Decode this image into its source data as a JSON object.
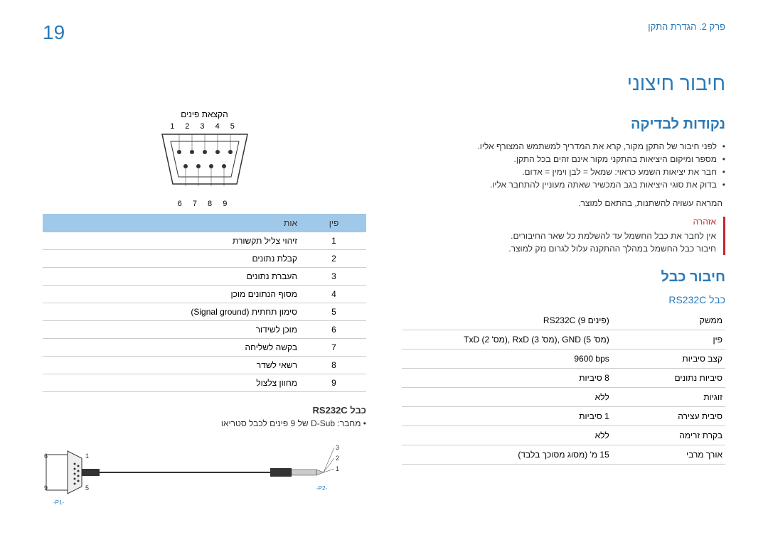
{
  "pageNumber": "19",
  "chapter": "פרק 2. הגדרת התקן",
  "mainTitle": "חיבור חיצוני",
  "section1": {
    "title": "נקודות לבדיקה",
    "bullets": [
      "לפני חיבור של התקן מקור, קרא את המדריך למשתמש המצורף אליו.",
      "מספר ומיקום היציאות בהתקני מקור אינם זהים בכל התקן.",
      "חבר את יציאות השמע כראוי: שמאל = לבן וימין = אדום.",
      "בדוק את סוגי היציאות בגב המכשיר שאתה מעוניין להתחבר אליו."
    ],
    "note": "המראה עשויה להשתנות, בהתאם למוצר.",
    "warning": {
      "title": "אזהרה",
      "line1": "אין לחבר את כבל החשמל עד להשלמת כל שאר החיבורים.",
      "line2": "חיבור כבל החשמל במהלך ההתקנה עלול לגרום נזק למוצר."
    }
  },
  "section2": {
    "title": "חיבור כבל",
    "sub": "כבל RS232C",
    "specs": [
      {
        "label": "ממשק",
        "value": "RS232C (9 פינים)"
      },
      {
        "label": "פין",
        "value": "TxD (מס' 2), RxD (מס' 3), GND (מס' 5)"
      },
      {
        "label": "קצב סיביות",
        "value": "9600 bps"
      },
      {
        "label": "סיביות נתונים",
        "value": "8 סיביות"
      },
      {
        "label": "זוגיות",
        "value": "ללא"
      },
      {
        "label": "סיבית עצירה",
        "value": "1 סיביות"
      },
      {
        "label": "בקרת זרימה",
        "value": "ללא"
      },
      {
        "label": "אורך מרבי",
        "value": "15 מ' (מסוג מסוכך בלבד)"
      }
    ]
  },
  "pinAssignment": {
    "title": "הקצאת פינים",
    "topNums": "1 2 3 4 5",
    "bottomNums": "6 7 8 9",
    "headers": {
      "pin": "פין",
      "signal": "אות"
    },
    "rows": [
      {
        "n": "1",
        "s": "זיהוי צליל תקשורת"
      },
      {
        "n": "2",
        "s": "קבלת נתונים"
      },
      {
        "n": "3",
        "s": "העברת נתונים"
      },
      {
        "n": "4",
        "s": "מסוף הנתונים מוכן"
      },
      {
        "n": "5",
        "s": "סימון תחתית (Signal ground)"
      },
      {
        "n": "6",
        "s": "מוכן לשידור"
      },
      {
        "n": "7",
        "s": "בקשה לשליחה"
      },
      {
        "n": "8",
        "s": "רשאי לשדר"
      },
      {
        "n": "9",
        "s": "מחוון צלצול"
      }
    ]
  },
  "cable": {
    "title": "כבל RS232C",
    "desc": "מחבר: D-Sub של 9 פינים לכבל סטריאו",
    "p1": "-P1-",
    "p2": "-P2-"
  }
}
